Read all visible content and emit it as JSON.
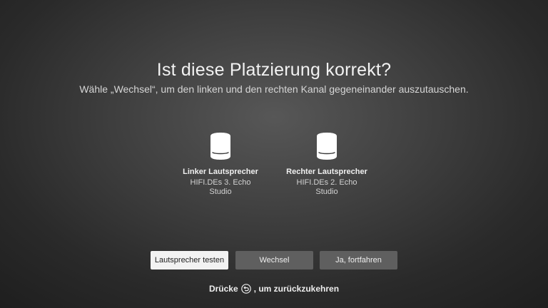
{
  "dialog": {
    "title": "Ist diese Platzierung korrekt?",
    "subtitle": "Wähle „Wechsel“, um den linken und den rechten Kanal gegeneinander auszutauschen."
  },
  "speakers": {
    "left": {
      "label": "Linker Lautsprecher",
      "device": "HIFI.DEs 3. Echo Studio",
      "icon": "echo-studio-speaker-icon"
    },
    "right": {
      "label": "Rechter Lautsprecher",
      "device": "HIFI.DEs 2. Echo Studio",
      "icon": "echo-studio-speaker-icon"
    }
  },
  "buttons": {
    "test": "Lautsprecher testen",
    "swap": "Wechsel",
    "continue": "Ja, fortfahren"
  },
  "hint": {
    "before": "Drücke",
    "after": "um zurückzukehren",
    "icon": "back-button-icon"
  },
  "colors": {
    "focused_button": "#f2f2f2",
    "button": "#5f5f5f",
    "background": "#2a2a2a"
  }
}
